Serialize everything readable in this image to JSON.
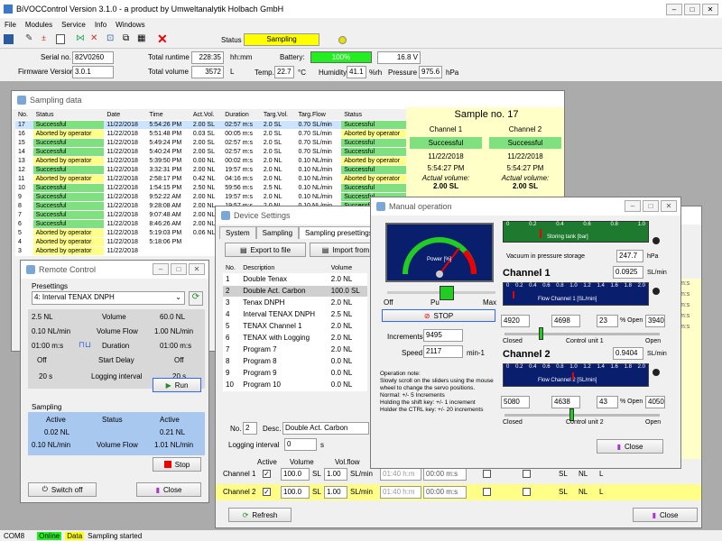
{
  "app": {
    "title": "BiVOCControl Version 3.1.0 - a product by Umweltanalytik Holbach GmbH",
    "menu": [
      "File",
      "Modules",
      "Service",
      "Info",
      "Windows"
    ]
  },
  "toolbar": {
    "status_label": "Status",
    "status_value": "Sampling"
  },
  "info": {
    "serial_label": "Serial no.",
    "serial": "82V0260",
    "firmware_label": "Firmware Version",
    "firmware": "3.0.1",
    "runtime_label": "Total runtime",
    "runtime": "228:35",
    "runtime_unit": "hh:mm",
    "volume_label": "Total volume",
    "volume": "3572",
    "volume_unit": "L",
    "battery_label": "Battery:",
    "battery_pct": "100%",
    "battery_v": "16.8 V",
    "temp_label": "Temp.",
    "temp": "22.7",
    "temp_unit": "°C",
    "hum_label": "Humidity",
    "hum": "41.1",
    "hum_unit": "%rh",
    "pres_label": "Pressure",
    "pres": "975.6",
    "pres_unit": "hPa"
  },
  "sampling": {
    "title": "Sampling data",
    "headers": [
      "No.",
      "Status",
      "Date",
      "Time",
      "Act.Vol.",
      "Duration",
      "Targ.Vol.",
      "Targ.Flow",
      "Status"
    ],
    "rows": [
      [
        "17",
        "Successful",
        "11/22/2018",
        "5:54:26 PM",
        "2.00 SL",
        "02:57 m:s",
        "2.0 SL",
        "0.70 SL/min",
        "Successful"
      ],
      [
        "16",
        "Aborted by operator",
        "11/22/2018",
        "5:51:48 PM",
        "0.03 SL",
        "00:05 m:s",
        "2.0 SL",
        "0.70 SL/min",
        "Aborted by operator"
      ],
      [
        "15",
        "Successful",
        "11/22/2018",
        "5:49:24 PM",
        "2.00 SL",
        "02:57 m:s",
        "2.0 SL",
        "0.70 SL/min",
        "Successful"
      ],
      [
        "14",
        "Successful",
        "11/22/2018",
        "5:40:24 PM",
        "2.00 SL",
        "02:57 m:s",
        "2.0 SL",
        "0.70 SL/min",
        "Successful"
      ],
      [
        "13",
        "Aborted by operator",
        "11/22/2018",
        "5:39:50 PM",
        "0.00 NL",
        "00:02 m:s",
        "2.0 NL",
        "0.10 NL/min",
        "Aborted by operator"
      ],
      [
        "12",
        "Successful",
        "11/22/2018",
        "3:32:31 PM",
        "2.00 NL",
        "19:57 m:s",
        "2.0 NL",
        "0.10 NL/min",
        "Successful"
      ],
      [
        "11",
        "Aborted by operator",
        "11/22/2018",
        "2:58:17 PM",
        "0.42 NL",
        "04:16 m:s",
        "2.0 NL",
        "0.10 NL/min",
        "Aborted by operator"
      ],
      [
        "10",
        "Successful",
        "11/22/2018",
        "1:54:15 PM",
        "2.50 NL",
        "59:56 m:s",
        "2.5 NL",
        "0.10 NL/min",
        "Successful"
      ],
      [
        "9",
        "Successful",
        "11/22/2018",
        "9:52:22 AM",
        "2.00 NL",
        "19:57 m:s",
        "2.0 NL",
        "0.10 NL/min",
        "Successful"
      ],
      [
        "8",
        "Successful",
        "11/22/2018",
        "9:28:08 AM",
        "2.00 NL",
        "19:57 m:s",
        "2.0 NL",
        "0.10 NL/min",
        "Successful"
      ],
      [
        "7",
        "Successful",
        "11/22/2018",
        "9:07:48 AM",
        "2.00 NL",
        "19:57 m:s",
        "2.0 NL",
        "0.10 NL/min",
        "Successful"
      ],
      [
        "6",
        "Successful",
        "11/22/2018",
        "8:46:26 AM",
        "2.00 NL",
        "19:57 m:s",
        "2.0 NL",
        "0.10 NL/min",
        "Successful"
      ],
      [
        "5",
        "Aborted by operator",
        "11/22/2018",
        "5:19:03 PM",
        "0.06 NL",
        "",
        "",
        "",
        ""
      ],
      [
        "4",
        "Aborted by operator",
        "11/22/2018",
        "5:18:06 PM",
        "",
        "",
        "",
        "",
        ""
      ],
      [
        "3",
        "Aborted by operator",
        "11/22/2018",
        "",
        "",
        "",
        "",
        "",
        ""
      ]
    ]
  },
  "sample": {
    "title": "Sample no. 17",
    "ch1": "Channel 1",
    "ch2": "Channel 2",
    "status": "Successful",
    "date": "11/22/2018",
    "time": "5:54:27 PM",
    "actual": "Actual volume:",
    "vol": "2.00 SL"
  },
  "remote": {
    "title": "Remote Control",
    "presettings": "Presettings",
    "preset": "4: Interval TENAX DNPH",
    "vol_l": "2.5 NL",
    "vol_mid": "Volume",
    "vol_r": "60.0 NL",
    "flow_l": "0.10 NL/min",
    "flow_mid": "Volume Flow",
    "flow_r": "1.00 NL/min",
    "dur_l": "01:00 m:s",
    "dur_mid": "Duration",
    "dur_r": "01:00 m:s",
    "sd_l": "Off",
    "sd_mid": "Start Delay",
    "sd_r": "Off",
    "li_l": "20 s",
    "li_mid": "Logging interval",
    "li_r": "20 s",
    "run": "Run",
    "sampling": "Sampling",
    "active": "Active",
    "status": "Status",
    "act_l": "0.02 NL",
    "act_r": "0.21 NL",
    "vf_l": "0.10 NL/min",
    "vf_mid": "Volume Flow",
    "vf_r": "1.01 NL/min",
    "stop": "Stop",
    "switch_off": "Switch off",
    "close": "Close"
  },
  "device": {
    "title": "Device Settings",
    "tabs": [
      "System",
      "Sampling",
      "Sampling presettings",
      "Ti"
    ],
    "export": "Export to file",
    "import": "Import from",
    "headers": [
      "No.",
      "Description",
      "Volume"
    ],
    "rows": [
      [
        "1",
        "Double Tenax",
        "2.0 NL"
      ],
      [
        "2",
        "Double Act. Carbon",
        "100.0 SL"
      ],
      [
        "3",
        "Tenax DNPH",
        "2.0 NL"
      ],
      [
        "4",
        "Interval TENAX DNPH",
        "2.5 NL"
      ],
      [
        "5",
        "TENAX Channel 1",
        "2.0 NL"
      ],
      [
        "6",
        "TENAX with Logging",
        "2.0 NL"
      ],
      [
        "7",
        "Program 7",
        "2.0 NL"
      ],
      [
        "8",
        "Program 8",
        "0.0 NL"
      ],
      [
        "9",
        "Program 9",
        "0.0 NL"
      ],
      [
        "10",
        "Program 10",
        "0.0 NL"
      ]
    ],
    "no_label": "No.",
    "no": "2",
    "desc_label": "Desc.",
    "desc": "Double Act. Carbon",
    "log_label": "Logging interval",
    "log": "0",
    "log_unit": "s",
    "active": "Active",
    "volume": "Volume",
    "volflow": "Vol.flow",
    "ch1": "Channel 1",
    "ch2": "Channel 2",
    "ch_vol": "100.0",
    "sl": "SL",
    "ch_flow": "1.00",
    "slmin": "SL/min",
    "t1": "01:40 h:m",
    "t2": "00:00 m:s",
    "rsl": "SL",
    "rnl": "NL",
    "rl": "L",
    "ms": "m:s",
    "refresh": "Refresh",
    "close": "Close"
  },
  "manual": {
    "title": "Manual operation",
    "gauge_label": "Power [%]",
    "off": "Off",
    "max": "Max",
    "pu": "Pu",
    "stop": "STOP",
    "incr_label": "Increments",
    "incr": "9495",
    "speed_label": "Speed",
    "speed": "2117",
    "speed_unit": "min-1",
    "note": "Operation note:\nSlowly scroll on the sliders using the mouse wheel to change the servo positions.\nNormal: +/- 5 Increments\nHolding the shift key: +/- 1 increment\nHolder the CTRL key: +/- 20 increments",
    "tank_label": "Storing tank [bar]",
    "vac_label": "Vacuum in pressure storage",
    "vac": "247.7",
    "vac_unit": "hPa",
    "ch1": "Channel 1",
    "ch1_flow": "0.0925",
    "ch2": "Channel 2",
    "ch2_flow": "0.9404",
    "flow_unit": "SL/min",
    "flow1_label": "Flow Channel 1 [SL/min]",
    "flow2_label": "Flow Channel 2 [SL/min]",
    "c1a": "4920",
    "c1b": "4698",
    "c1c": "23",
    "c1d": "3940",
    "c2a": "5080",
    "c2b": "4638",
    "c2c": "43",
    "c2d": "4050",
    "open_pct": "% Open",
    "closed": "Closed",
    "open": "Open",
    "cu1": "Control unit 1",
    "cu2": "Control unit 2",
    "close": "Close",
    "scale": [
      "0",
      "0.2",
      "0.4",
      "0.6",
      "0.8",
      "1.0",
      "1.2",
      "1.4",
      "1.6",
      "1.8",
      "2.0"
    ],
    "tank_scale": [
      "0",
      "0.2",
      "0.4",
      "0.6",
      "0.8",
      "1.0"
    ]
  },
  "statusbar": {
    "port": "COM8",
    "online": "Online",
    "data": "Data",
    "msg": "Sampling started"
  },
  "colors": {
    "ok": "#7fe07f",
    "abort": "#ffff88",
    "panel_blue": "#a9c8f0",
    "yellow": "#ffffc8"
  }
}
